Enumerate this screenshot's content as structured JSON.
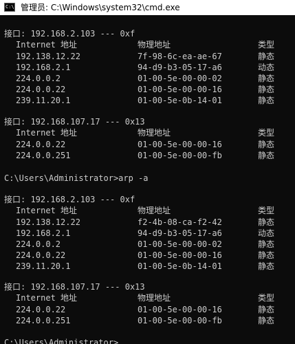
{
  "window": {
    "title": "管理员: C:\\Windows\\system32\\cmd.exe",
    "icon": "cmd-icon",
    "icon_text": "C:\\"
  },
  "console": {
    "blocks": [
      {
        "header": "接口: 192.168.2.103 --- 0xf",
        "columns": [
          "Internet 地址",
          "物理地址",
          "类型"
        ],
        "rows": [
          [
            "192.138.12.22",
            "7f-98-6c-ea-ae-67",
            "静态"
          ],
          [
            "192.168.2.1",
            "94-d9-b3-05-17-a6",
            "动态"
          ],
          [
            "224.0.0.2",
            "01-00-5e-00-00-02",
            "静态"
          ],
          [
            "224.0.0.22",
            "01-00-5e-00-00-16",
            "静态"
          ],
          [
            "239.11.20.1",
            "01-00-5e-0b-14-01",
            "静态"
          ]
        ]
      },
      {
        "header": "接口: 192.168.107.17 --- 0x13",
        "columns": [
          "Internet 地址",
          "物理地址",
          "类型"
        ],
        "rows": [
          [
            "224.0.0.22",
            "01-00-5e-00-00-16",
            "静态"
          ],
          [
            "224.0.0.251",
            "01-00-5e-00-00-fb",
            "静态"
          ]
        ]
      },
      {
        "header": "接口: 192.168.2.103 --- 0xf",
        "columns": [
          "Internet 地址",
          "物理地址",
          "类型"
        ],
        "rows": [
          [
            "192.138.12.22",
            "f2-4b-08-ca-f2-42",
            "静态"
          ],
          [
            "192.168.2.1",
            "94-d9-b3-05-17-a6",
            "动态"
          ],
          [
            "224.0.0.2",
            "01-00-5e-00-00-02",
            "静态"
          ],
          [
            "224.0.0.22",
            "01-00-5e-00-00-16",
            "静态"
          ],
          [
            "239.11.20.1",
            "01-00-5e-0b-14-01",
            "静态"
          ]
        ]
      },
      {
        "header": "接口: 192.168.107.17 --- 0x13",
        "columns": [
          "Internet 地址",
          "物理地址",
          "类型"
        ],
        "rows": [
          [
            "224.0.0.22",
            "01-00-5e-00-00-16",
            "静态"
          ],
          [
            "224.0.0.251",
            "01-00-5e-00-00-fb",
            "静态"
          ]
        ]
      }
    ],
    "command_prompt": "C:\\Users\\Administrator>arp -a",
    "trailing_prompt": "C:\\Users\\Administrator>",
    "text_color": "#cccccc",
    "background_color": "#0c0c0c"
  }
}
